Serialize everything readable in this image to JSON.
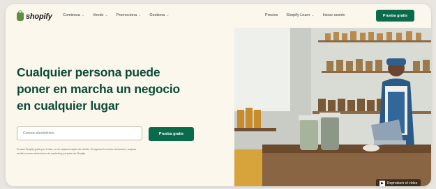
{
  "brand": {
    "name": "shopify",
    "accent": "#0a6b4b",
    "headline_color": "#0b4a37"
  },
  "nav": {
    "items": [
      {
        "label": "Comienza"
      },
      {
        "label": "Vende"
      },
      {
        "label": "Promociona"
      },
      {
        "label": "Gestiona"
      }
    ],
    "right": {
      "pricing": "Precios",
      "learn": "Shopify Learn",
      "login": "Iniciar sesión",
      "cta": "Prueba gratis"
    }
  },
  "hero": {
    "headline_line1": "Cualquier persona puede",
    "headline_line2": "poner en marcha un negocio",
    "headline_line3": "en cualquier lugar",
    "email_placeholder": "Correo electrónico",
    "cta": "Prueba gratis",
    "fineprint_line1": "Prueba Shopify gratis por 3 días, no se requiere tarjeta de crédito. Al ingresar tu correo electrónico, aceptas",
    "fineprint_line2": "recibir correos electrónicos de marketing por parte de Shopify."
  },
  "video": {
    "label": "Reproducir el vídeo",
    "icon": "play-icon"
  }
}
